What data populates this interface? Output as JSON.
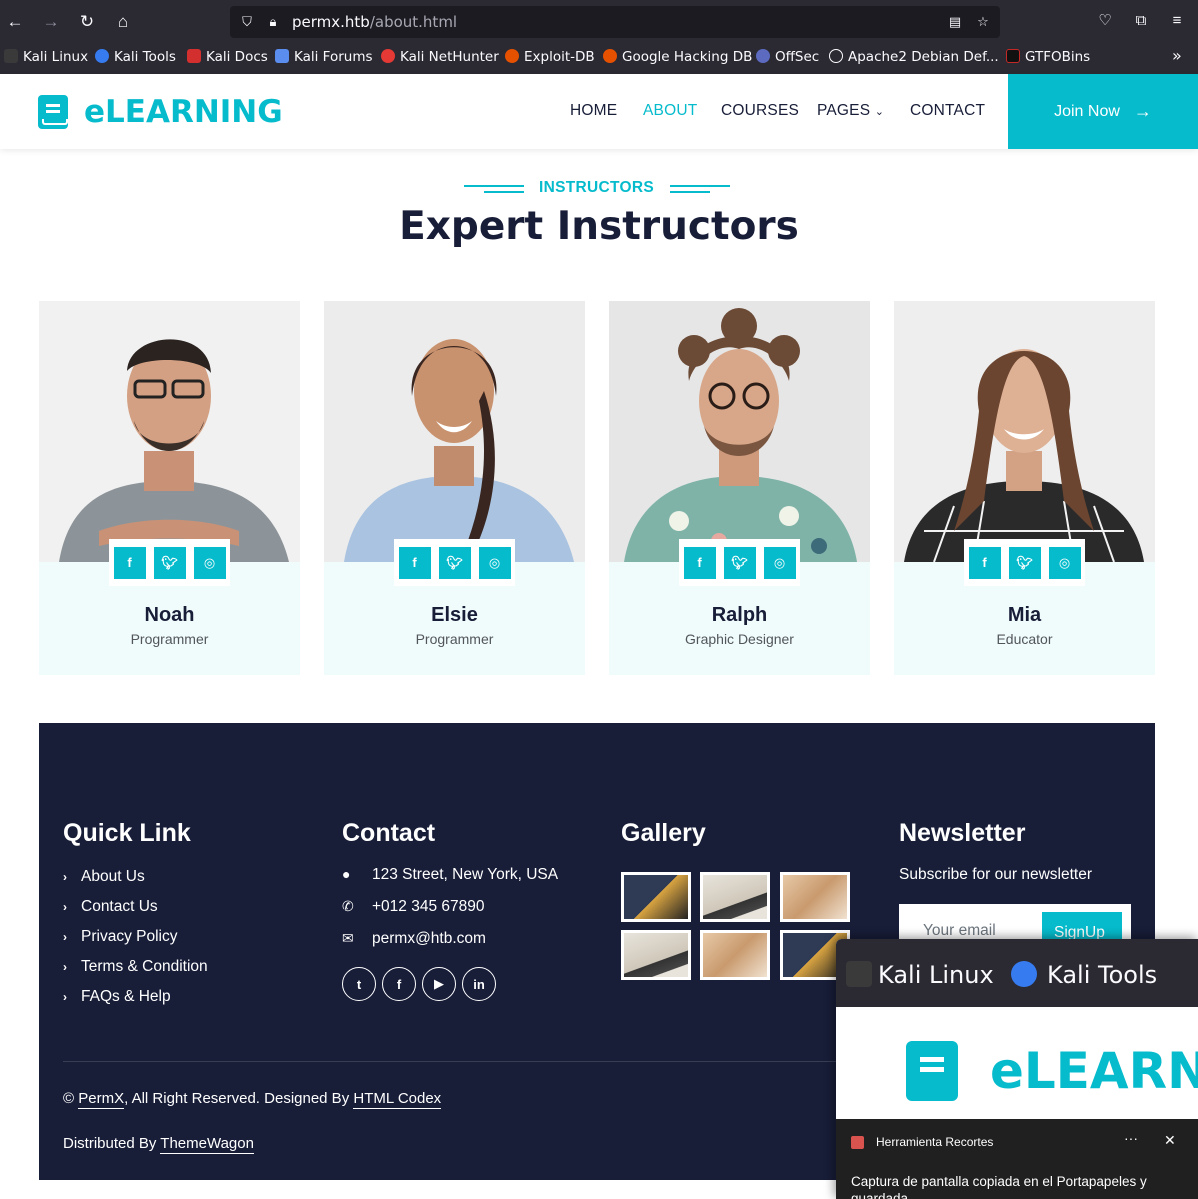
{
  "browser": {
    "url_host": "permx.htb",
    "url_path": "/about.html",
    "bookmarks": [
      "Kali Linux",
      "Kali Tools",
      "Kali Docs",
      "Kali Forums",
      "Kali NetHunter",
      "Exploit-DB",
      "Google Hacking DB",
      "OffSec",
      "Apache2 Debian Def...",
      "GTFOBins"
    ]
  },
  "site": {
    "logo": "eLEARNING",
    "menu": [
      "HOME",
      "ABOUT",
      "COURSES",
      "PAGES",
      "CONTACT"
    ],
    "active_menu": "ABOUT",
    "join_label": "Join Now",
    "accent": "#06bbcc",
    "dark": "#181d38"
  },
  "instructors": {
    "label": "INSTRUCTORS",
    "title": "Expert Instructors",
    "items": [
      {
        "name": "Noah",
        "role": "Programmer"
      },
      {
        "name": "Elsie",
        "role": "Programmer"
      },
      {
        "name": "Ralph",
        "role": "Graphic Designer"
      },
      {
        "name": "Mia",
        "role": "Educator"
      }
    ]
  },
  "footer": {
    "quick_link_title": "Quick Link",
    "quick_links": [
      "About Us",
      "Contact Us",
      "Privacy Policy",
      "Terms & Condition",
      "FAQs & Help"
    ],
    "contact_title": "Contact",
    "address": "123 Street, New York, USA",
    "phone": "+012 345 67890",
    "email": "permx@htb.com",
    "gallery_title": "Gallery",
    "newsletter_title": "Newsletter",
    "newsletter_text": "Subscribe for our newsletter",
    "email_placeholder": "Your email",
    "signup_label": "SignUp",
    "copyright_prefix": "©",
    "copyright_brand": "PermX",
    "copyright_mid": ", All Right Reserved. Designed By",
    "copyright_designer": "HTML Codex",
    "distributed_prefix": "Distributed By",
    "distributed_by": "ThemeWagon"
  },
  "popup": {
    "preview_bookmarks": [
      "Kali Linux",
      "Kali Tools"
    ],
    "preview_logo": "eLEARN",
    "app_name": "Herramienta Recortes",
    "more": "···",
    "close": "✕",
    "message": "Captura de pantalla copiada en el Portapapeles y guardada"
  }
}
